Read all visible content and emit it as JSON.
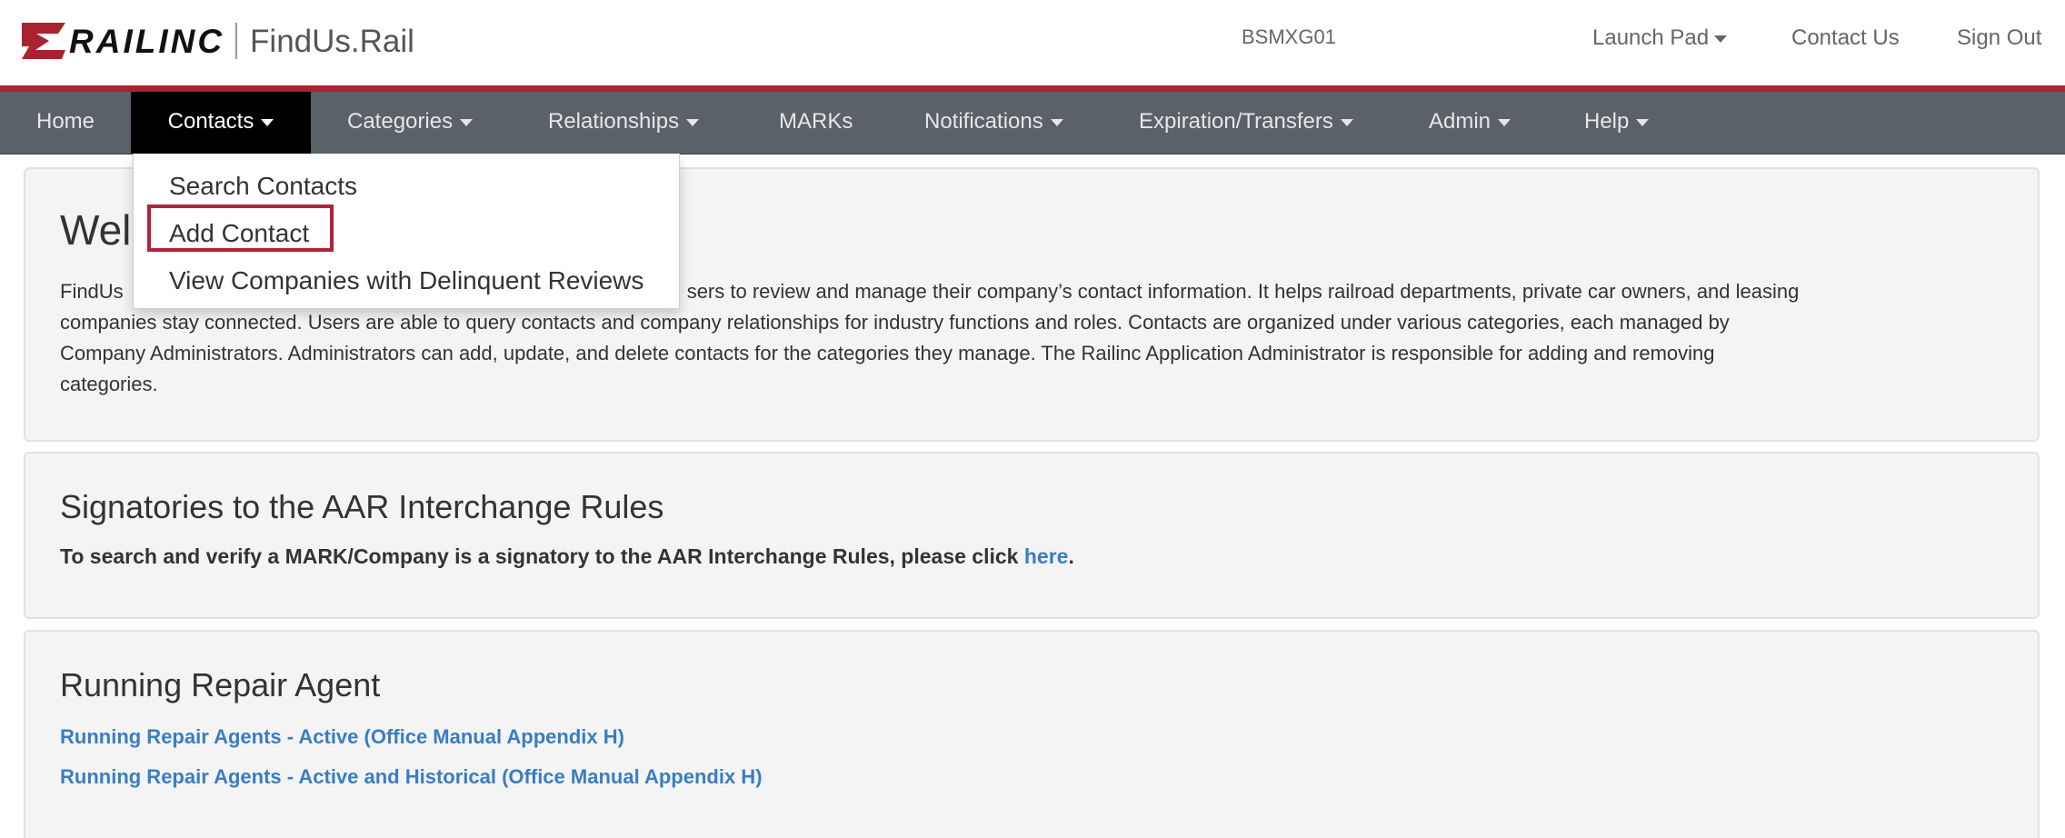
{
  "brand": {
    "logo_text": "RAILINC",
    "app_name": "FindUs.Rail",
    "mark_color": "#a8232f"
  },
  "top_bar": {
    "user_id": "BSMXG01",
    "launch_pad": "Launch Pad",
    "contact_us": "Contact Us",
    "sign_out": "Sign Out"
  },
  "nav": {
    "home": "Home",
    "contacts": "Contacts",
    "categories": "Categories",
    "relationships": "Relationships",
    "marks": "MARKs",
    "notifications": "Notifications",
    "expiration": "Expiration/Transfers",
    "admin": "Admin",
    "help": "Help"
  },
  "contacts_menu": {
    "search": "Search Contacts",
    "add": "Add Contact",
    "delinquent": "View Companies with Delinquent Reviews"
  },
  "welcome": {
    "title_visible": "Wel",
    "line1_start": "FindUs",
    "line1_rest": "sers to review and manage their company’s contact information. It helps railroad departments, private car owners, and leasing",
    "line2": "companies stay connected. Users are able to query contacts and company relationships for industry functions and roles. Contacts are organized under various categories, each managed by",
    "line3": "Company Administrators. Administrators can add, update, and delete contacts for the categories they manage. The Railinc Application Administrator is responsible for adding and removing",
    "line4": "categories."
  },
  "signatories": {
    "title": "Signatories to the AAR Interchange Rules",
    "text": "To search and verify a MARK/Company is a signatory to the AAR Interchange Rules, please click",
    "link": "here",
    "suffix": "."
  },
  "running_repair": {
    "title": "Running Repair Agent",
    "link_active": "Running Repair Agents - Active (Office Manual Appendix H)",
    "link_historical": "Running Repair Agents - Active and Historical (Office Manual Appendix H)"
  },
  "colors": {
    "accent_red": "#a8232f",
    "navbar": "#5a6168",
    "link_blue": "#3a7dc2",
    "highlight": "#b4213a"
  }
}
